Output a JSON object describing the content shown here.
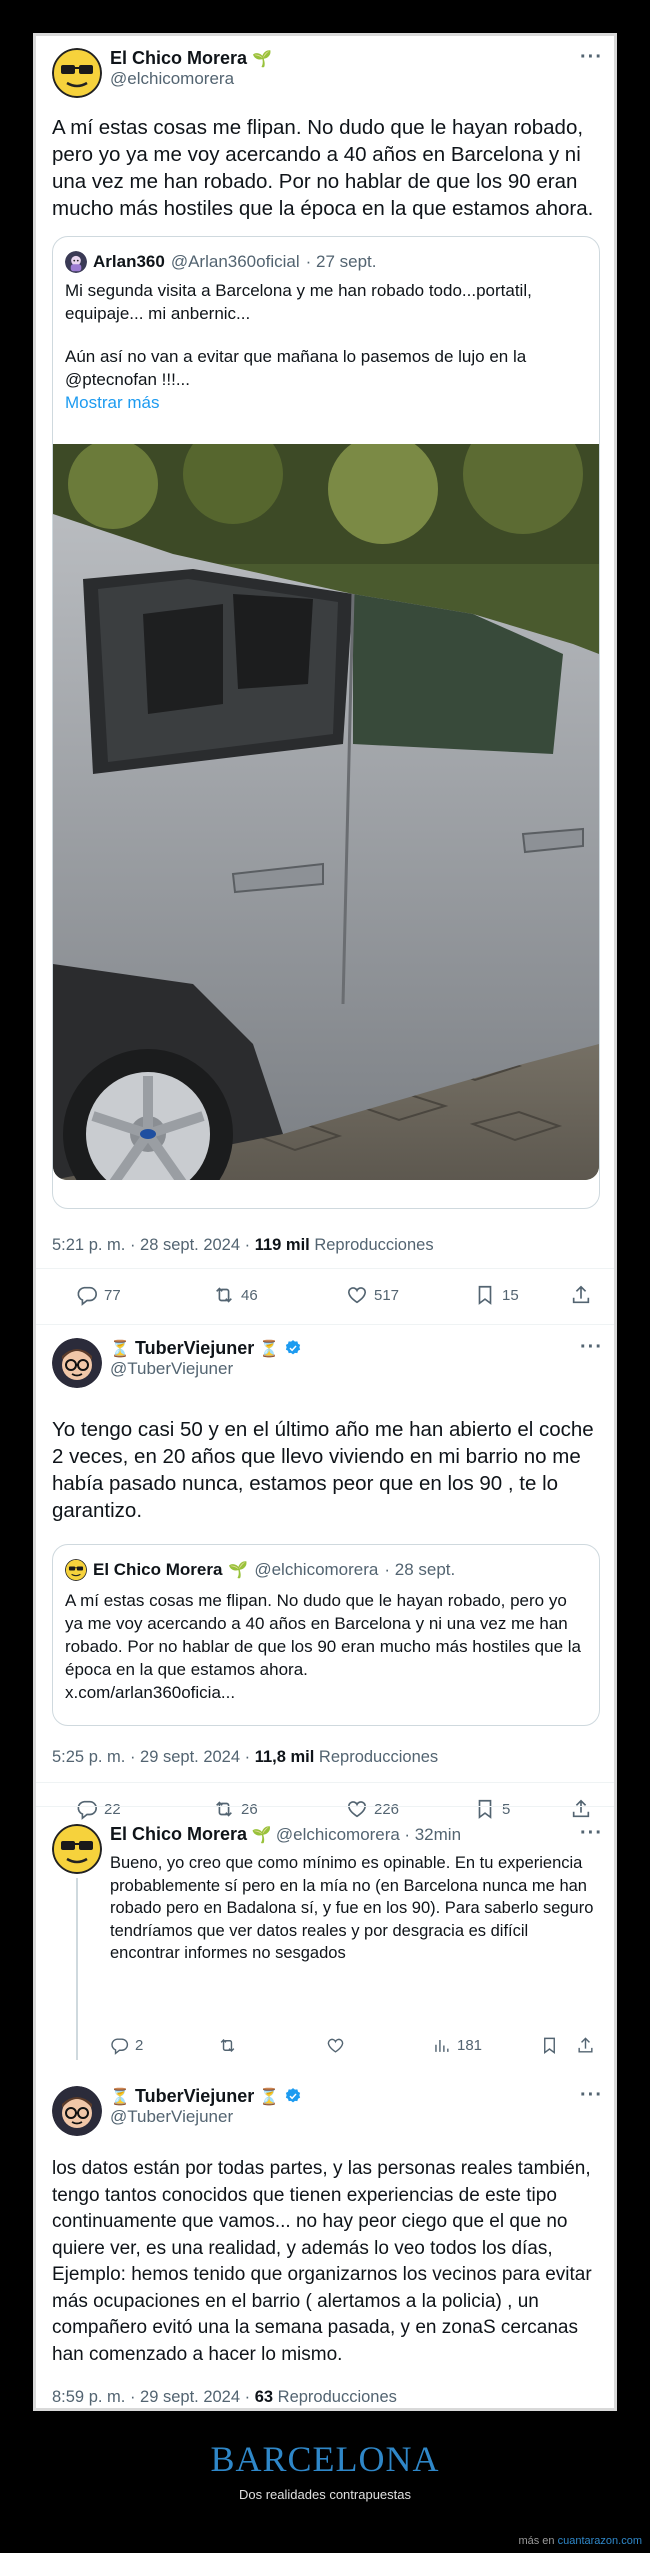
{
  "tweet1": {
    "author_name": "El Chico Morera",
    "author_handle": "@elchicomorera",
    "text": "A mí estas cosas me flipan. No dudo que le hayan robado, pero yo ya me voy acercando a 40 años en Barcelona y ni una vez me han robado. Por no hablar de que los 90 eran mucho más hostiles que la época en la que estamos ahora.",
    "quote": {
      "author_name": "Arlan360",
      "author_handle": "@Arlan360oficial",
      "date": "· 27 sept.",
      "text_1": "Mi segunda visita a Barcelona y me han robado todo...portatil, equipaje... mi anbernic...",
      "text_2": "Aún así no van a evitar que mañana lo pasemos de lujo en la @ptecnofan !!!...",
      "show_more": "Mostrar más"
    },
    "time": "5:21 p. m. · 28 sept. 2024 · ",
    "views": "119 mil",
    "views_label": " Reproducciones",
    "replies": "77",
    "retweets": "46",
    "likes": "517",
    "bookmarks": "15"
  },
  "tweet2": {
    "author_name": "TuberViejuner",
    "author_handle": "@TuberViejuner",
    "text": "Yo tengo casi 50 y en el último año me han abierto el coche 2 veces, en 20 años que llevo viviendo en mi barrio no me había pasado nunca, estamos peor que en los 90 , te lo garantizo.",
    "quote": {
      "author_name": "El Chico Morera",
      "author_handle": "@elchicomorera",
      "date": "· 28 sept.",
      "text": "A mí estas cosas me flipan. No dudo que le hayan robado, pero yo ya me voy acercando a 40 años en Barcelona y ni una vez me han robado. Por no hablar de que los 90 eran mucho más hostiles que la época en la que estamos ahora.",
      "url": "x.com/arlan360oficia..."
    },
    "time": "5:25 p. m. · 29 sept. 2024 · ",
    "views": "11,8 mil",
    "views_label": " Reproducciones",
    "replies": "22",
    "retweets": "26",
    "likes": "226",
    "bookmarks": "5"
  },
  "reply1": {
    "author_name": "El Chico Morera",
    "author_handle": "@elchicomorera",
    "age": "· 32min",
    "text": "Bueno, yo creo que como mínimo es opinable. En tu experiencia probablemente sí pero en la mía no (en Barcelona nunca me han robado pero en Badalona sí, y fue en los 90). Para saberlo seguro tendríamos que ver datos reales  y por desgracia es difícil encontrar informes no sesgados",
    "replies": "2",
    "views": "181"
  },
  "tweet3": {
    "author_name": "TuberViejuner",
    "author_handle": "@TuberViejuner",
    "text": "los datos están por todas partes, y las personas reales también, tengo tantos conocidos que tienen experiencias de este tipo continuamente que vamos... no hay peor ciego que el que no quiere ver, es una realidad, y además lo veo todos los días, Ejemplo:  hemos tenido que organizarnos los vecinos para evitar más ocupaciones en el barrio ( alertamos a la policia) , un compañero evitó una la semana pasada, y en zonaS cercanas han comenzado a hacer lo mismo.",
    "time": "8:59 p. m. · 29 sept. 2024 · ",
    "views": "63",
    "views_label": " Reproducciones"
  },
  "footer": {
    "title": "BARCELONA",
    "subtitle": "Dos realidades contrapuestas",
    "credit_prefix": "más en ",
    "credit_brand": "cuantarazon.com"
  },
  "icons": {
    "more": "more-horizontal-icon",
    "reply": "reply-icon",
    "retweet": "retweet-icon",
    "like": "heart-icon",
    "bookmark": "bookmark-icon",
    "share": "share-icon",
    "views": "bar-chart-icon",
    "verified": "verified-badge-icon"
  },
  "colors": {
    "link": "#1d9bf0",
    "verified": "#1d9bf0",
    "footer_title": "#2f87c8",
    "muted": "#536471"
  }
}
